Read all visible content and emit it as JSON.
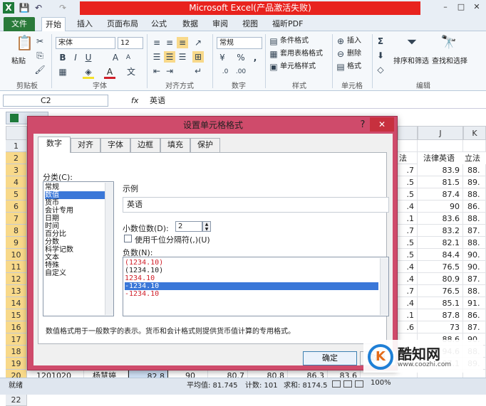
{
  "window": {
    "title": "Microsoft Excel(产品激活失败)",
    "win_min": "–",
    "win_max": "□",
    "win_close": "✕"
  },
  "quick_access": {
    "excel_icon": "X",
    "save_icon": "💾",
    "undo_icon": "↶",
    "redo_icon": "↷"
  },
  "ribbon": {
    "tabs": [
      "文件",
      "开始",
      "插入",
      "页面布局",
      "公式",
      "数据",
      "审阅",
      "视图",
      "福昕PDF"
    ],
    "clipboard": {
      "paste": "粘贴",
      "label": "剪贴板"
    },
    "font": {
      "name": "宋体",
      "size": "12",
      "bold": "B",
      "italic": "I",
      "underline": "U",
      "grow": "A",
      "shrink": "A",
      "label": "字体",
      "fill_color": "#f5e12a",
      "font_color": "#d0202a"
    },
    "alignment": {
      "label": "对齐方式"
    },
    "number": {
      "format": "常规",
      "percent": "%",
      "comma": ",",
      "label": "数字"
    },
    "styles": {
      "conditional": "条件格式",
      "table_format": "套用表格格式",
      "cell_styles": "单元格样式",
      "label": "样式"
    },
    "cells": {
      "insert": "插入",
      "delete": "删除",
      "format": "格式",
      "label": "单元格"
    },
    "editing": {
      "sort_filter": "排序和筛选",
      "find_select": "查找和选择",
      "label": "编辑",
      "sigma": "Σ"
    }
  },
  "formula_bar": {
    "name_box": "C2",
    "fx": "fx",
    "content": "英语"
  },
  "grid": {
    "col_headers": [
      {
        "label": "J"
      },
      {
        "label": "K"
      }
    ],
    "visible_header_cells": [
      "法",
      "法律英语",
      "立法"
    ],
    "row_numbers": [
      "1",
      "2",
      "3",
      "4",
      "5",
      "6",
      "7",
      "8",
      "9",
      "10",
      "11",
      "12",
      "13",
      "14",
      "15",
      "16",
      "17",
      "18",
      "19",
      "20",
      "21",
      "22"
    ],
    "col_i": [
      "",
      "",
      ".7",
      ".5",
      ".5",
      ".4",
      ".1",
      ".7",
      ".5",
      ".5",
      ".4",
      ".4",
      ".7",
      ".4",
      ".1",
      ".6",
      "",
      ".2",
      ".7",
      "",
      "",
      ""
    ],
    "col_j": [
      "",
      "",
      "83.9",
      "81.5",
      "87.4",
      "90",
      "83.6",
      "83.2",
      "82.1",
      "84.4",
      "76.5",
      "80.9",
      "76.5",
      "85.1",
      "87.8",
      "73",
      "88.6",
      "94.6",
      "87.1",
      "",
      "",
      ""
    ],
    "col_k": [
      "",
      "",
      "88.",
      "89.",
      "88.",
      "86.",
      "88.",
      "87.",
      "88.",
      "90.",
      "90.",
      "87.",
      "88.",
      "91.",
      "86.",
      "87.",
      "90.",
      "88.",
      "89.",
      "",
      "",
      ""
    ],
    "row22": [
      "1201020",
      "杨慧婷",
      "82.8",
      "90",
      "80.7",
      "80.8",
      "86.3",
      "83.6"
    ]
  },
  "status_bar": {
    "ready": "就绪",
    "average": "平均值: 81.745",
    "count": "计数: 101",
    "sum": "求和: 8174.5",
    "zoom": "100%"
  },
  "dialog": {
    "title": "设置单元格格式",
    "help": "?",
    "close": "✕",
    "tabs": [
      "数字",
      "对齐",
      "字体",
      "边框",
      "填充",
      "保护"
    ],
    "active_tab": 0,
    "category_label": "分类(C):",
    "categories": [
      "常规",
      "数值",
      "货币",
      "会计专用",
      "日期",
      "时间",
      "百分比",
      "分数",
      "科学记数",
      "文本",
      "特殊",
      "自定义"
    ],
    "selected_category": 1,
    "sample_label": "示例",
    "sample_value": "英语",
    "decimal_label": "小数位数(D):",
    "decimal_value": "2",
    "thousand_sep_label": "使用千位分隔符(,)(U)",
    "negative_label": "负数(N):",
    "negative_options": [
      {
        "text": "(1234.10)",
        "red": true
      },
      {
        "text": "(1234.10)",
        "red": false
      },
      {
        "text": "1234.10",
        "red": true
      },
      {
        "text": "-1234.10",
        "red": false
      },
      {
        "text": "-1234.10",
        "red": true
      }
    ],
    "selected_negative": 3,
    "description": "数值格式用于一般数字的表示。货币和会计格式则提供货币值计算的专用格式。",
    "ok": "确定",
    "cancel": "取消"
  },
  "watermark": {
    "logo": "K",
    "name": "酷知网",
    "url": "www.coozhi.com"
  }
}
